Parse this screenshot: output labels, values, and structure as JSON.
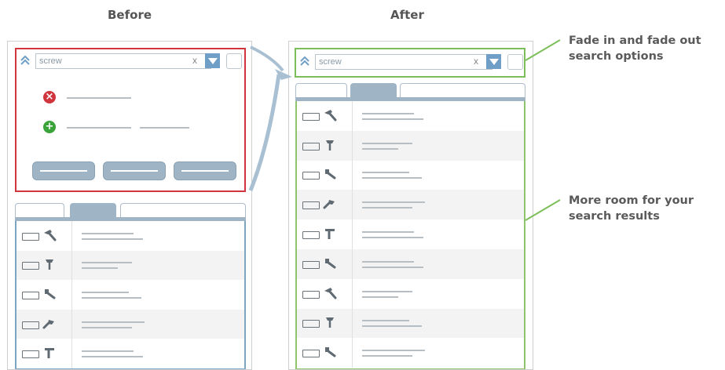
{
  "before": {
    "heading": "Before",
    "search_value": "screw",
    "clear_label": "x",
    "options": [
      {
        "icon": "remove-icon",
        "glyph": "×",
        "color": "#d0343c"
      },
      {
        "icon": "add-icon",
        "glyph": "+",
        "color": "#3aa33a"
      }
    ],
    "action_buttons": 3,
    "results": [
      {
        "tool": "hammer-icon"
      },
      {
        "tool": "screw-icon"
      },
      {
        "tool": "screwdriver-icon"
      },
      {
        "tool": "drill-icon"
      },
      {
        "tool": "nail-icon"
      }
    ]
  },
  "after": {
    "heading": "After",
    "search_value": "screw",
    "clear_label": "x",
    "results": [
      {
        "tool": "hammer-icon"
      },
      {
        "tool": "screw-icon"
      },
      {
        "tool": "screwdriver-icon"
      },
      {
        "tool": "drill-icon"
      },
      {
        "tool": "nail-icon"
      },
      {
        "tool": "screwdriver-icon"
      },
      {
        "tool": "hammer-icon"
      },
      {
        "tool": "screw-icon"
      },
      {
        "tool": "screwdriver-icon"
      }
    ]
  },
  "annotations": {
    "fade_line1": "Fade in and fade out",
    "fade_line2": "search options",
    "room_line1": "More room for your",
    "room_line2": "search results"
  },
  "colors": {
    "before_accent": "#d0343c",
    "after_accent": "#7cbf5a",
    "results_blue": "#7aa6c4",
    "button_blue": "#9fb5c6"
  }
}
